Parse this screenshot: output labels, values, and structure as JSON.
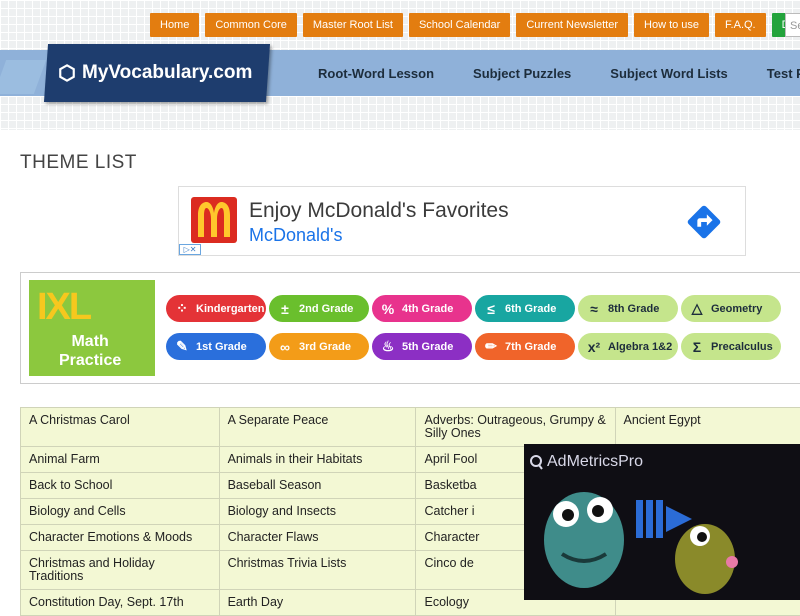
{
  "topnav": {
    "items": [
      "Home",
      "Common Core",
      "Master Root List",
      "School Calendar",
      "Current Newsletter",
      "How to use",
      "F.A.Q."
    ],
    "donate": "Donate",
    "search_placeholder": "Se"
  },
  "logo": {
    "text": "MyVocabulary.com"
  },
  "mainnav": {
    "items": [
      "Root-Word Lesson",
      "Subject Puzzles",
      "Subject Word Lists",
      "Test Pre"
    ]
  },
  "page": {
    "title": "THEME LIST"
  },
  "ad_mcdonalds": {
    "headline": "Enjoy McDonald's Favorites",
    "brand": "McDonald's",
    "adchoices": "▷✕"
  },
  "ad_ixl": {
    "logo": "IXL",
    "subtitle_line1": "Math",
    "subtitle_line2": "Practice",
    "row1": [
      {
        "label": "Kindergarten",
        "icon": "dots-icon",
        "glyph": "⁘",
        "color": "#e43337"
      },
      {
        "label": "2nd Grade",
        "icon": "plus-minus-icon",
        "glyph": "±",
        "color": "#6abf2d"
      },
      {
        "label": "4th Grade",
        "icon": "percent-icon",
        "glyph": "%",
        "color": "#e8338d"
      },
      {
        "label": "6th Grade",
        "icon": "less-equal-icon",
        "glyph": "≤",
        "color": "#18a6a1"
      },
      {
        "label": "8th Grade",
        "icon": "approx-icon",
        "glyph": "≈",
        "color": "#c5e58c"
      },
      {
        "label": "Geometry",
        "icon": "triangle-icon",
        "glyph": "△",
        "color": "#c5e58c"
      }
    ],
    "row2": [
      {
        "label": "1st Grade",
        "icon": "pencil-cup-icon",
        "glyph": "✎",
        "color": "#2a6fdc"
      },
      {
        "label": "3rd Grade",
        "icon": "infinity-icon",
        "glyph": "∞",
        "color": "#f39c18"
      },
      {
        "label": "5th Grade",
        "icon": "cake-icon",
        "glyph": "♨",
        "color": "#8c2fc4"
      },
      {
        "label": "7th Grade",
        "icon": "pencil-icon",
        "glyph": "✏",
        "color": "#f0642a"
      },
      {
        "label": "Algebra 1&2",
        "icon": "x-squared-icon",
        "glyph": "x²",
        "color": "#c5e58c"
      },
      {
        "label": "Precalculus",
        "icon": "sigma-icon",
        "glyph": "Σ",
        "color": "#c5e58c"
      }
    ]
  },
  "themes": {
    "rows": [
      [
        "A Christmas Carol",
        "A Separate Peace",
        "Adverbs: Outrageous, Grumpy & Silly Ones",
        "Ancient Egypt"
      ],
      [
        "Animal Farm",
        "Animals in their Habitats",
        "April Fool",
        ""
      ],
      [
        "Back to School",
        "Baseball Season",
        "Basketba",
        ""
      ],
      [
        "Biology and Cells",
        "Biology and Insects",
        "Catcher i",
        ""
      ],
      [
        "Character Emotions & Moods",
        "Character Flaws",
        "Character",
        ""
      ],
      [
        "Christmas and Holiday Traditions",
        "Christmas Trivia Lists",
        "Cinco de",
        ""
      ],
      [
        "Constitution Day, Sept. 17th",
        "Earth Day",
        "Ecology",
        ""
      ]
    ]
  },
  "video_ad": {
    "brand": "AdMetricsPro"
  }
}
